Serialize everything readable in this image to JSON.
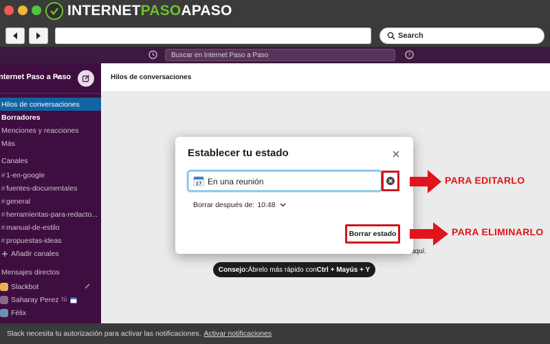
{
  "browser": {
    "logo_part1": "INTERNET",
    "logo_part2": "PASO",
    "logo_part3": "APASO",
    "search_placeholder": "Search",
    "icons": [
      "back-arrow-icon",
      "forward-arrow-icon",
      "search-icon"
    ],
    "colors": {
      "logo_accent": "#6fbf2f"
    }
  },
  "slack_topbar": {
    "search_placeholder": "Buscar en Internet Paso a Paso",
    "icons": [
      "history-icon",
      "help-icon"
    ]
  },
  "sidebar": {
    "workspace_name": "nternet Paso a Paso",
    "nav": [
      {
        "label": "Hilos de conversaciones",
        "active": true
      },
      {
        "label": "Borradores",
        "bold": true
      },
      {
        "label": "Menciones y reacciones"
      },
      {
        "label": "Más"
      }
    ],
    "channels_header": "Canales",
    "channels": [
      "1-en-google",
      "fuentes-documentales",
      "general",
      "herramientas-para-redacto...",
      "manual-de-estilo",
      "propuestas-ideas"
    ],
    "add_channels": "Añadir canales",
    "dm_header": "Mensajes directos",
    "dms": [
      {
        "name": "Slackbot"
      },
      {
        "name": "Saharay Perez",
        "suffix": "tú"
      },
      {
        "name": "Félix"
      }
    ],
    "colors": {
      "background": "#3f0e40",
      "active": "#1164a3"
    }
  },
  "main": {
    "title": "Hilos de conversaciones",
    "background_fragment": "aquí."
  },
  "modal": {
    "title": "Establecer tu estado",
    "status_value": "En una reunión",
    "clear_after_label": "Borrar después de:",
    "clear_after_value": "10:48",
    "clear_status_button": "Borrar estado",
    "icons": [
      "close-icon",
      "calendar-icon",
      "clear-circle-icon",
      "chevron-down-icon"
    ]
  },
  "annotations": {
    "edit": "PARA EDITARLO",
    "delete": "PARA ELIMINARLO",
    "color": "#e0141a"
  },
  "tooltip": {
    "prefix": "Consejo:",
    "text": " Ábrelo más rápido con ",
    "shortcut": "Ctrl + Mayús + Y"
  },
  "notification": {
    "text": "Slack necesita tu autorización para activar las notificaciones.",
    "link": "Activar notificaciones"
  }
}
